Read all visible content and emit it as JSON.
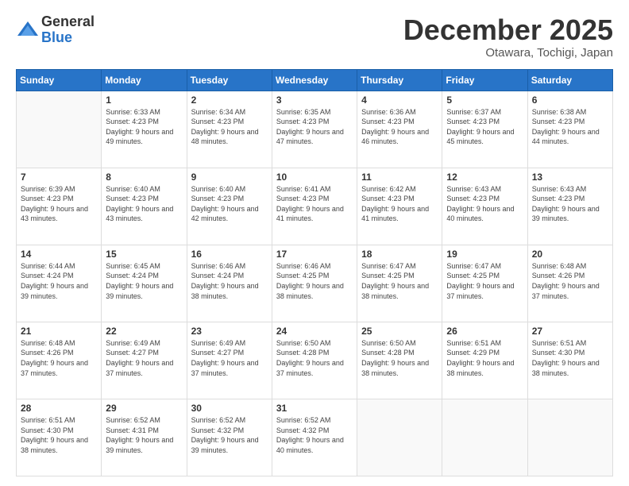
{
  "logo": {
    "general": "General",
    "blue": "Blue"
  },
  "title": "December 2025",
  "location": "Otawara, Tochigi, Japan",
  "days_of_week": [
    "Sunday",
    "Monday",
    "Tuesday",
    "Wednesday",
    "Thursday",
    "Friday",
    "Saturday"
  ],
  "weeks": [
    [
      {
        "day": "",
        "sunrise": "",
        "sunset": "",
        "daylight": ""
      },
      {
        "day": "1",
        "sunrise": "Sunrise: 6:33 AM",
        "sunset": "Sunset: 4:23 PM",
        "daylight": "Daylight: 9 hours and 49 minutes."
      },
      {
        "day": "2",
        "sunrise": "Sunrise: 6:34 AM",
        "sunset": "Sunset: 4:23 PM",
        "daylight": "Daylight: 9 hours and 48 minutes."
      },
      {
        "day": "3",
        "sunrise": "Sunrise: 6:35 AM",
        "sunset": "Sunset: 4:23 PM",
        "daylight": "Daylight: 9 hours and 47 minutes."
      },
      {
        "day": "4",
        "sunrise": "Sunrise: 6:36 AM",
        "sunset": "Sunset: 4:23 PM",
        "daylight": "Daylight: 9 hours and 46 minutes."
      },
      {
        "day": "5",
        "sunrise": "Sunrise: 6:37 AM",
        "sunset": "Sunset: 4:23 PM",
        "daylight": "Daylight: 9 hours and 45 minutes."
      },
      {
        "day": "6",
        "sunrise": "Sunrise: 6:38 AM",
        "sunset": "Sunset: 4:23 PM",
        "daylight": "Daylight: 9 hours and 44 minutes."
      }
    ],
    [
      {
        "day": "7",
        "sunrise": "Sunrise: 6:39 AM",
        "sunset": "Sunset: 4:23 PM",
        "daylight": "Daylight: 9 hours and 43 minutes."
      },
      {
        "day": "8",
        "sunrise": "Sunrise: 6:40 AM",
        "sunset": "Sunset: 4:23 PM",
        "daylight": "Daylight: 9 hours and 43 minutes."
      },
      {
        "day": "9",
        "sunrise": "Sunrise: 6:40 AM",
        "sunset": "Sunset: 4:23 PM",
        "daylight": "Daylight: 9 hours and 42 minutes."
      },
      {
        "day": "10",
        "sunrise": "Sunrise: 6:41 AM",
        "sunset": "Sunset: 4:23 PM",
        "daylight": "Daylight: 9 hours and 41 minutes."
      },
      {
        "day": "11",
        "sunrise": "Sunrise: 6:42 AM",
        "sunset": "Sunset: 4:23 PM",
        "daylight": "Daylight: 9 hours and 41 minutes."
      },
      {
        "day": "12",
        "sunrise": "Sunrise: 6:43 AM",
        "sunset": "Sunset: 4:23 PM",
        "daylight": "Daylight: 9 hours and 40 minutes."
      },
      {
        "day": "13",
        "sunrise": "Sunrise: 6:43 AM",
        "sunset": "Sunset: 4:23 PM",
        "daylight": "Daylight: 9 hours and 39 minutes."
      }
    ],
    [
      {
        "day": "14",
        "sunrise": "Sunrise: 6:44 AM",
        "sunset": "Sunset: 4:24 PM",
        "daylight": "Daylight: 9 hours and 39 minutes."
      },
      {
        "day": "15",
        "sunrise": "Sunrise: 6:45 AM",
        "sunset": "Sunset: 4:24 PM",
        "daylight": "Daylight: 9 hours and 39 minutes."
      },
      {
        "day": "16",
        "sunrise": "Sunrise: 6:46 AM",
        "sunset": "Sunset: 4:24 PM",
        "daylight": "Daylight: 9 hours and 38 minutes."
      },
      {
        "day": "17",
        "sunrise": "Sunrise: 6:46 AM",
        "sunset": "Sunset: 4:25 PM",
        "daylight": "Daylight: 9 hours and 38 minutes."
      },
      {
        "day": "18",
        "sunrise": "Sunrise: 6:47 AM",
        "sunset": "Sunset: 4:25 PM",
        "daylight": "Daylight: 9 hours and 38 minutes."
      },
      {
        "day": "19",
        "sunrise": "Sunrise: 6:47 AM",
        "sunset": "Sunset: 4:25 PM",
        "daylight": "Daylight: 9 hours and 37 minutes."
      },
      {
        "day": "20",
        "sunrise": "Sunrise: 6:48 AM",
        "sunset": "Sunset: 4:26 PM",
        "daylight": "Daylight: 9 hours and 37 minutes."
      }
    ],
    [
      {
        "day": "21",
        "sunrise": "Sunrise: 6:48 AM",
        "sunset": "Sunset: 4:26 PM",
        "daylight": "Daylight: 9 hours and 37 minutes."
      },
      {
        "day": "22",
        "sunrise": "Sunrise: 6:49 AM",
        "sunset": "Sunset: 4:27 PM",
        "daylight": "Daylight: 9 hours and 37 minutes."
      },
      {
        "day": "23",
        "sunrise": "Sunrise: 6:49 AM",
        "sunset": "Sunset: 4:27 PM",
        "daylight": "Daylight: 9 hours and 37 minutes."
      },
      {
        "day": "24",
        "sunrise": "Sunrise: 6:50 AM",
        "sunset": "Sunset: 4:28 PM",
        "daylight": "Daylight: 9 hours and 37 minutes."
      },
      {
        "day": "25",
        "sunrise": "Sunrise: 6:50 AM",
        "sunset": "Sunset: 4:28 PM",
        "daylight": "Daylight: 9 hours and 38 minutes."
      },
      {
        "day": "26",
        "sunrise": "Sunrise: 6:51 AM",
        "sunset": "Sunset: 4:29 PM",
        "daylight": "Daylight: 9 hours and 38 minutes."
      },
      {
        "day": "27",
        "sunrise": "Sunrise: 6:51 AM",
        "sunset": "Sunset: 4:30 PM",
        "daylight": "Daylight: 9 hours and 38 minutes."
      }
    ],
    [
      {
        "day": "28",
        "sunrise": "Sunrise: 6:51 AM",
        "sunset": "Sunset: 4:30 PM",
        "daylight": "Daylight: 9 hours and 38 minutes."
      },
      {
        "day": "29",
        "sunrise": "Sunrise: 6:52 AM",
        "sunset": "Sunset: 4:31 PM",
        "daylight": "Daylight: 9 hours and 39 minutes."
      },
      {
        "day": "30",
        "sunrise": "Sunrise: 6:52 AM",
        "sunset": "Sunset: 4:32 PM",
        "daylight": "Daylight: 9 hours and 39 minutes."
      },
      {
        "day": "31",
        "sunrise": "Sunrise: 6:52 AM",
        "sunset": "Sunset: 4:32 PM",
        "daylight": "Daylight: 9 hours and 40 minutes."
      },
      {
        "day": "",
        "sunrise": "",
        "sunset": "",
        "daylight": ""
      },
      {
        "day": "",
        "sunrise": "",
        "sunset": "",
        "daylight": ""
      },
      {
        "day": "",
        "sunrise": "",
        "sunset": "",
        "daylight": ""
      }
    ]
  ]
}
